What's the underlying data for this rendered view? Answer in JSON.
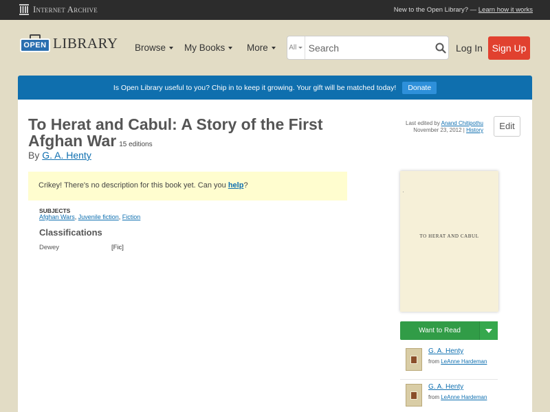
{
  "ia_bar": {
    "logo_text": "Internet Archive",
    "new_text": "New to the Open Library? —",
    "learn_link": "Learn how it works"
  },
  "header": {
    "logo_open": "OPEN",
    "logo_library": "LIBRARY",
    "nav": {
      "browse": "Browse",
      "my_books": "My Books",
      "more": "More"
    },
    "search": {
      "scope": "All",
      "placeholder": "Search"
    },
    "login": "Log In",
    "signup": "Sign Up"
  },
  "donate": {
    "text": "Is Open Library useful to you? Chip in to keep it growing. Your gift will be matched today!",
    "button": "Donate"
  },
  "book": {
    "title": "To Herat and Cabul: A Story of the First Afghan War",
    "editions": "15 editions",
    "by": "By",
    "author": "G. A. Henty",
    "edited_prefix": "Last edited by",
    "edited_by": "Anand Chitipothu",
    "edited_date": "November 23, 2012 |",
    "history": "History",
    "edit_button": "Edit",
    "nodesc_text": "Crikey! There's no description for this book yet. Can you",
    "nodesc_link": "help",
    "nodesc_end": "?",
    "subjects_label": "SUBJECTS",
    "subjects": [
      "Afghan Wars",
      "Juvenile fiction",
      "Fiction"
    ],
    "classifications_title": "Classifications",
    "dewey_label": "Dewey",
    "dewey_value": "[Fic]",
    "cover_title": "TO HERAT AND CABUL"
  },
  "sidebar": {
    "want_to_read": "Want to Read",
    "lists": [
      {
        "author": "G. A. Henty",
        "from_prefix": "from",
        "from_user": "LeAnne Hardeman"
      },
      {
        "author": "G. A. Henty",
        "from_prefix": "from",
        "from_user": "LeAnne Hardeman"
      }
    ]
  },
  "colors": {
    "signup": "#e1412f",
    "donate_bar": "#0f6fae",
    "want_to_read": "#319c47",
    "link": "#0e6fb0"
  }
}
